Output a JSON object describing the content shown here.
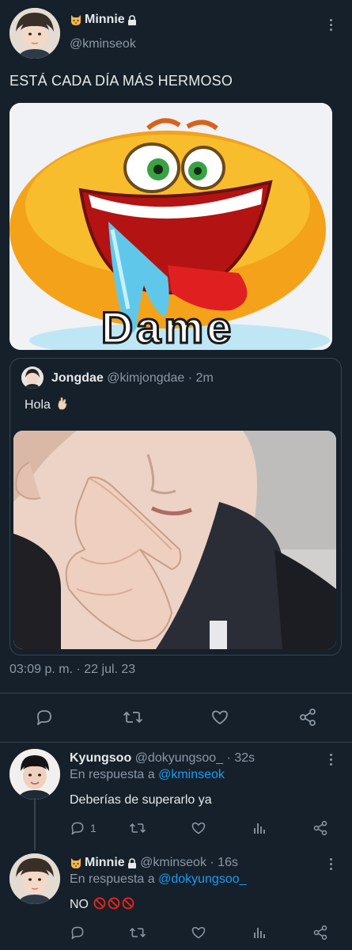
{
  "main_tweet": {
    "display_name": "Minnie",
    "handle": "@kminseok",
    "text": "ESTÁ CADA DÍA MÁS HERMOSO",
    "meme_caption": "Dame",
    "timestamp": "03:09 p. m. · 22 jul. 23",
    "icons": [
      "cat-face-icon",
      "lock-icon",
      "more-icon"
    ]
  },
  "quoted_tweet": {
    "display_name": "Jongdae",
    "handle": "@kimjongdae",
    "time": "· 2m",
    "text": "Hola",
    "emoji": "hand-emoji-icon"
  },
  "action_bar": {
    "icons": [
      "reply-icon",
      "retweet-icon",
      "like-icon",
      "share-icon"
    ]
  },
  "replies": [
    {
      "display_name": "Kyungsoo",
      "handle": "@dokyungsoo_",
      "time": "· 32s",
      "reply_prefix": "En respuesta a",
      "reply_to": "@kminseok",
      "text": "Deberías de superarlo ya",
      "reply_count": "1"
    },
    {
      "display_name": "Minnie",
      "handle": "@kminseok",
      "time": "· 16s",
      "reply_prefix": "En respuesta a",
      "reply_to": "@dokyungsoo_",
      "text": "NO",
      "text_emojis": [
        "no-entry-icon",
        "no-entry-icon",
        "no-entry-icon"
      ],
      "reply_count": ""
    }
  ],
  "colors": {
    "background": "#15202b",
    "text": "#e7e9ea",
    "muted": "#8b98a5",
    "link": "#1d9bf0",
    "border": "#38444d"
  }
}
